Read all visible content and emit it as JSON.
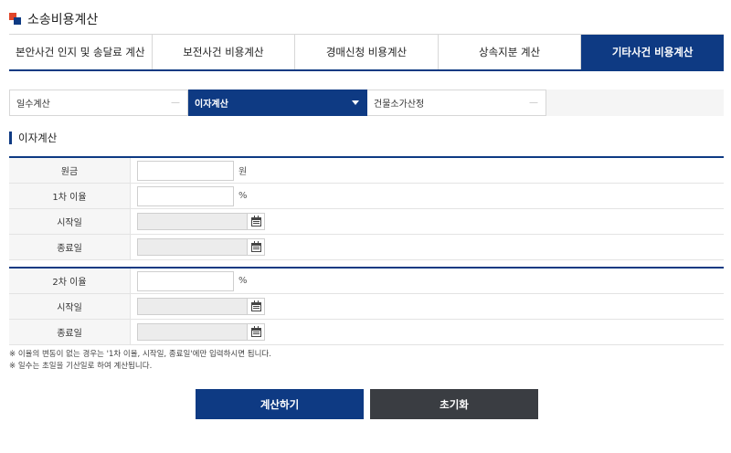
{
  "header": {
    "title": "소송비용계산"
  },
  "main_tabs": [
    {
      "label": "본안사건 인지 및 송달료 계산",
      "active": false
    },
    {
      "label": "보전사건 비용계산",
      "active": false
    },
    {
      "label": "경매신청 비용계산",
      "active": false
    },
    {
      "label": "상속지분 계산",
      "active": false
    },
    {
      "label": "기타사건 비용계산",
      "active": true
    }
  ],
  "sub_tabs": [
    {
      "label": "일수계산",
      "active": false
    },
    {
      "label": "이자계산",
      "active": true
    },
    {
      "label": "건물소가산정",
      "active": false
    }
  ],
  "section": {
    "title": "이자계산"
  },
  "form1": {
    "principal": {
      "label": "원금",
      "value": "",
      "unit": "원"
    },
    "rate1": {
      "label": "1차 이율",
      "value": "",
      "unit": "%"
    },
    "start1": {
      "label": "시작일",
      "value": ""
    },
    "end1": {
      "label": "종료일",
      "value": ""
    }
  },
  "form2": {
    "rate2": {
      "label": "2차 이율",
      "value": "",
      "unit": "%"
    },
    "start2": {
      "label": "시작일",
      "value": ""
    },
    "end2": {
      "label": "종료일",
      "value": ""
    }
  },
  "notes": [
    "※ 이율의 변동이 없는 경우는 '1차 이율, 시작일, 종료일'에만 입력하시면 됩니다.",
    "※ 일수는 초일을 기산일로 하여 계산됩니다."
  ],
  "buttons": {
    "calculate": "계산하기",
    "reset": "초기화"
  },
  "colors": {
    "primary": "#0e3a83",
    "dark_button": "#3a3d42",
    "accent": "#e0452a"
  },
  "icons": {
    "calendar": "calendar-icon",
    "logo": "logo-mark"
  }
}
